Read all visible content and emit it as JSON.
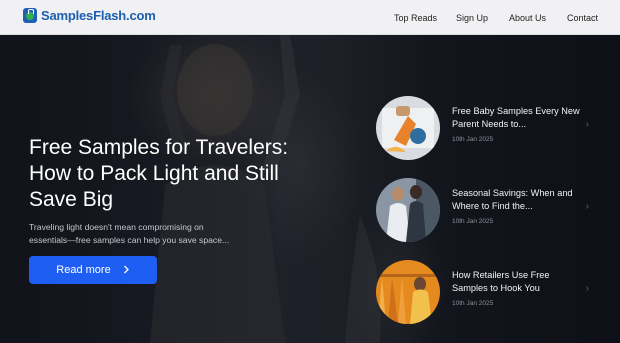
{
  "header": {
    "logo_text": "SamplesFlash.com",
    "nav": [
      {
        "label": "Top Reads"
      },
      {
        "label": "Sign Up"
      },
      {
        "label": "About Us"
      },
      {
        "label": "Contact"
      }
    ]
  },
  "hero": {
    "title": "Free Samples for Travelers: How to Pack Light and Still Save Big",
    "excerpt": "Traveling light doesn't mean compromising on essentials—free samples can help you save space...",
    "cta_label": "Read more",
    "cta_icon": "chevron-right-icon",
    "accent_color": "#1f5ef2"
  },
  "sidebar": {
    "posts": [
      {
        "title": "Free Baby Samples Every New Parent Needs to...",
        "date": "10th Jan 2025"
      },
      {
        "title": "Seasonal Savings: When and Where to Find the...",
        "date": "10th Jan 2025"
      },
      {
        "title": "How Retailers Use Free Samples to Hook You",
        "date": "10th Jan 2025"
      }
    ]
  }
}
